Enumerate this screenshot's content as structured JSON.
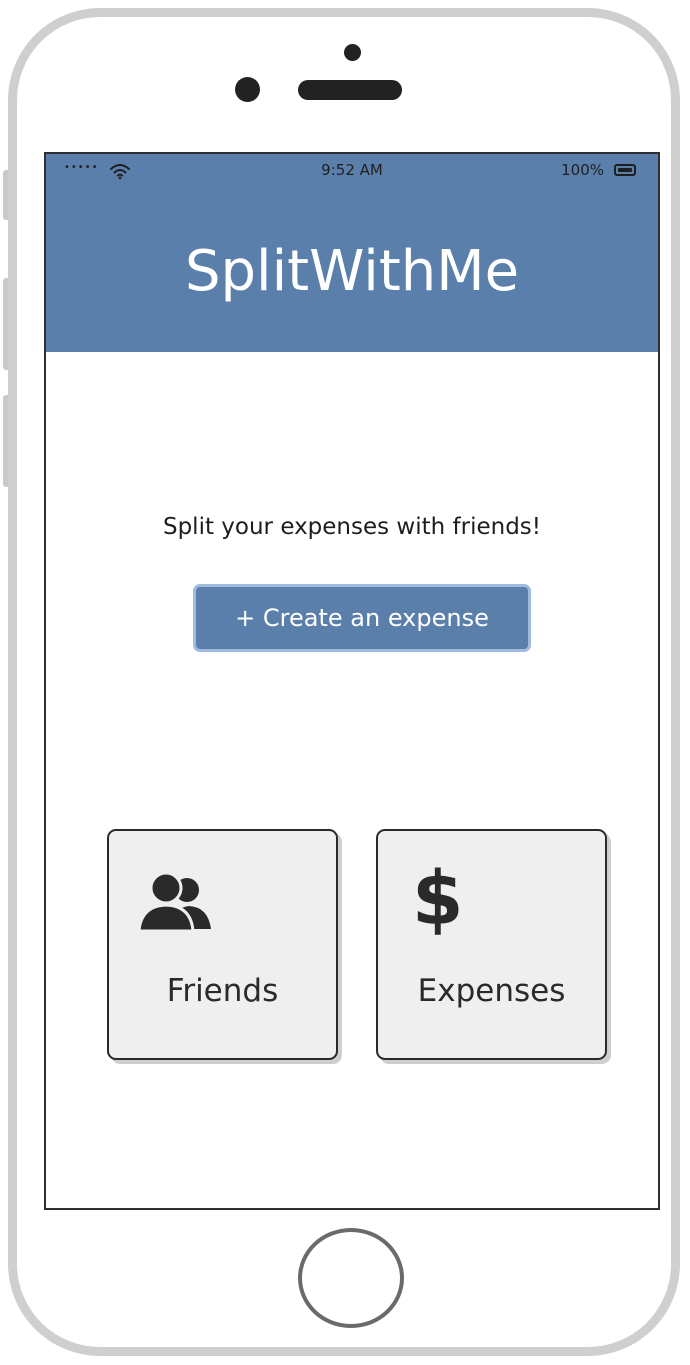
{
  "status_bar": {
    "signal": "•••••",
    "time": "9:52 AM",
    "battery": "100%"
  },
  "app": {
    "title": "SplitWithMe",
    "tagline": "Split your expenses with friends!",
    "create_button_label": "+ Create an expense"
  },
  "tiles": [
    {
      "label": "Friends",
      "icon": "people-icon"
    },
    {
      "label": "Expenses",
      "icon": "dollar-icon"
    }
  ],
  "dollar_symbol": "$",
  "colors": {
    "header": "#5a7fab",
    "button": "#5a7fab",
    "tile_background": "#efefef"
  }
}
